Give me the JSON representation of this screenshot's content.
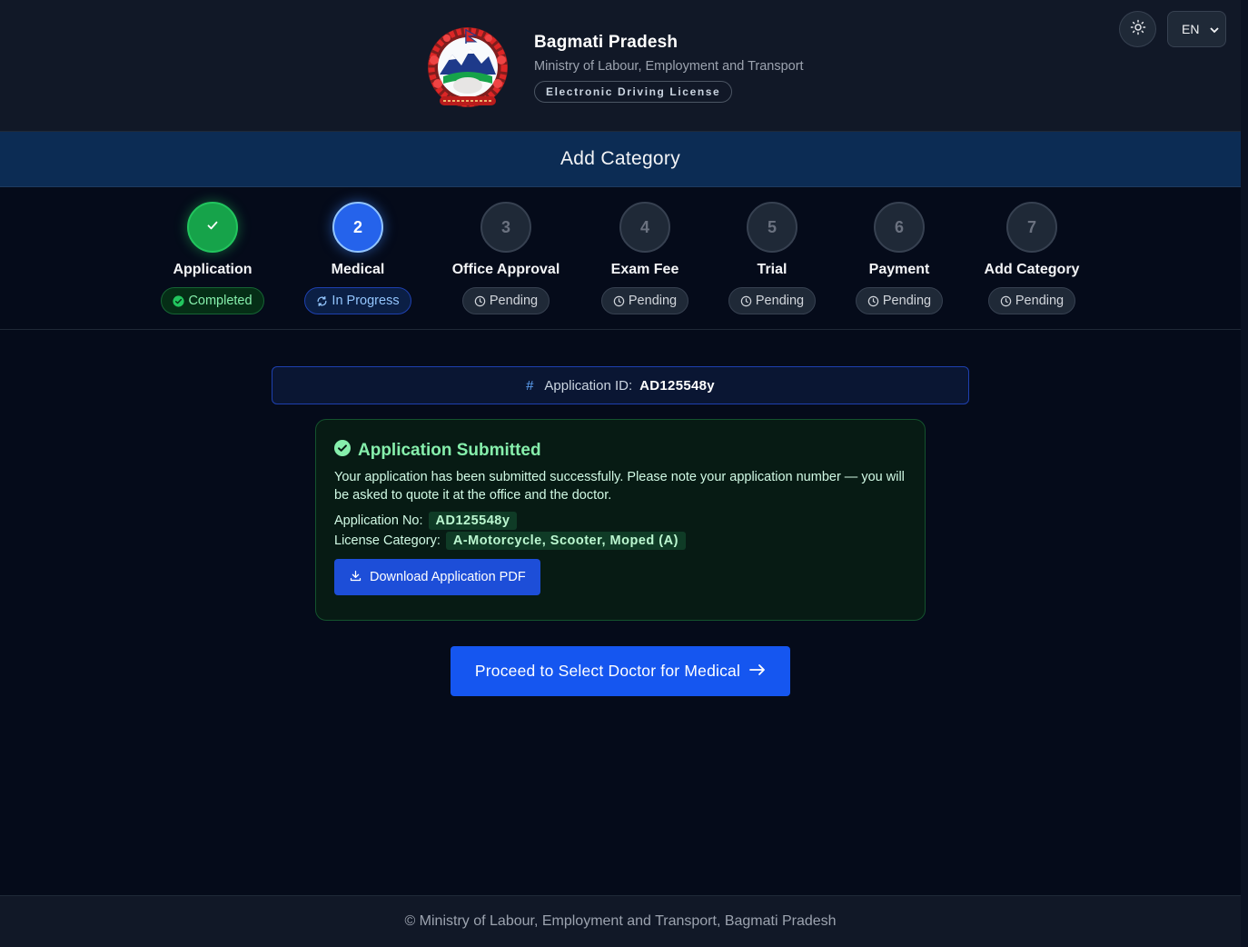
{
  "header": {
    "title": "Bagmati Pradesh",
    "subtitle": "Ministry of Labour, Employment and Transport",
    "badge": "Electronic Driving License",
    "language": "EN",
    "theme_icon": "sun-icon",
    "emblem_icon": "nepal-emblem-icon"
  },
  "page": {
    "title": "Add Category"
  },
  "stepper": {
    "steps": [
      {
        "number": "",
        "label": "Application",
        "status": "Completed",
        "state": "done"
      },
      {
        "number": "2",
        "label": "Medical",
        "status": "In Progress",
        "state": "active"
      },
      {
        "number": "3",
        "label": "Office Approval",
        "status": "Pending",
        "state": "pending"
      },
      {
        "number": "4",
        "label": "Exam Fee",
        "status": "Pending",
        "state": "pending"
      },
      {
        "number": "5",
        "label": "Trial",
        "status": "Pending",
        "state": "pending"
      },
      {
        "number": "6",
        "label": "Payment",
        "status": "Pending",
        "state": "pending"
      },
      {
        "number": "7",
        "label": "Add Category",
        "status": "Pending",
        "state": "pending"
      }
    ]
  },
  "application": {
    "hash_symbol": "#",
    "id_label": "Application ID:",
    "id_value": "AD125548y"
  },
  "success": {
    "title": "Application Submitted",
    "message": "Your application has been submitted successfully. Please note your application number — you will be asked to quote it at the office and the doctor.",
    "app_no_label": "Application No:",
    "app_no_value": "AD125548y",
    "category_label": "License Category:",
    "category_value": "A-Motorcycle, Scooter, Moped (A)",
    "download_label": "Download Application PDF"
  },
  "proceed": {
    "label": "Proceed to Select Doctor for Medical"
  },
  "footer": {
    "text": "© Ministry of Labour, Employment and Transport, Bagmati Pradesh"
  },
  "colors": {
    "background": "#050b1a",
    "header": "#111827",
    "title_bar": "#0c2c54",
    "done": "#16a34a",
    "active": "#2563eb",
    "success_text": "#86efac",
    "primary_button": "#1556f0"
  }
}
